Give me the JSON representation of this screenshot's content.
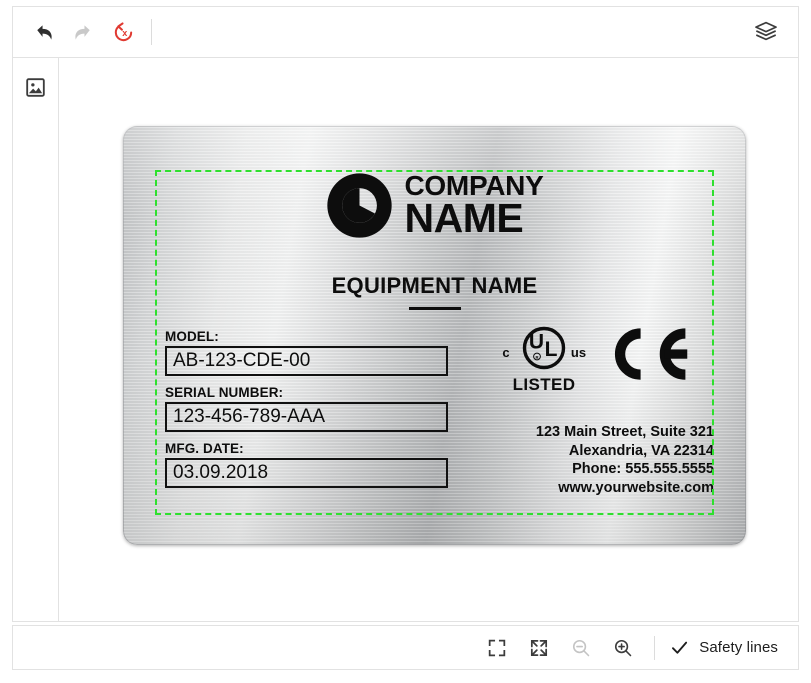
{
  "toolbar": {
    "undo": {
      "name": "Undo",
      "icon": "undo-icon",
      "enabled": true
    },
    "redo": {
      "name": "Redo",
      "icon": "redo-icon",
      "enabled": false
    },
    "reset": {
      "name": "Reset",
      "icon": "reset-icon",
      "enabled": true,
      "color": "#e03a32"
    },
    "layers": {
      "name": "Layers",
      "icon": "layers-icon",
      "enabled": true
    }
  },
  "sidebar": {
    "items": [
      {
        "name": "Image",
        "icon": "image-icon"
      }
    ]
  },
  "bottombar": {
    "fit_screen": {
      "name": "Fit to screen",
      "icon": "fit-screen-icon",
      "enabled": true
    },
    "fullscreen": {
      "name": "Fullscreen",
      "icon": "expand-icon",
      "enabled": true
    },
    "zoom_out": {
      "name": "Zoom out",
      "icon": "zoom-out-icon",
      "enabled": false
    },
    "zoom_in": {
      "name": "Zoom in",
      "icon": "zoom-in-icon",
      "enabled": true
    },
    "safety_lines": {
      "label": "Safety lines",
      "icon": "check-icon",
      "checked": true
    }
  },
  "plate": {
    "logo": {
      "mark": "circle-c-logo",
      "line1": "COMPANY",
      "line2": "NAME"
    },
    "equipment_name": "EQUIPMENT NAME",
    "fields": [
      {
        "label": "MODEL:",
        "value": "AB-123-CDE-00",
        "name": "model"
      },
      {
        "label": "SERIAL NUMBER:",
        "value": "123-456-789-AAA",
        "name": "serial-number"
      },
      {
        "label": "MFG. DATE:",
        "value": "03.09.2018",
        "name": "mfg-date"
      }
    ],
    "certifications": {
      "ul": {
        "prefix": "c",
        "suffix": "us",
        "letters": "UL",
        "registered": "®",
        "caption": "LISTED"
      },
      "ce": {
        "name": "CE mark"
      }
    },
    "address": {
      "line1": "123 Main Street, Suite 321",
      "line2": "Alexandria, VA 22314",
      "line3": "Phone: 555.555.5555",
      "line4": "www.yourwebsite.com"
    }
  },
  "colors": {
    "safety_line": "#2ee02e",
    "reset_icon": "#e03a32",
    "disabled_icon": "#c4c4c4",
    "icon": "#3c3c3c",
    "border": "#e2e2e2"
  }
}
